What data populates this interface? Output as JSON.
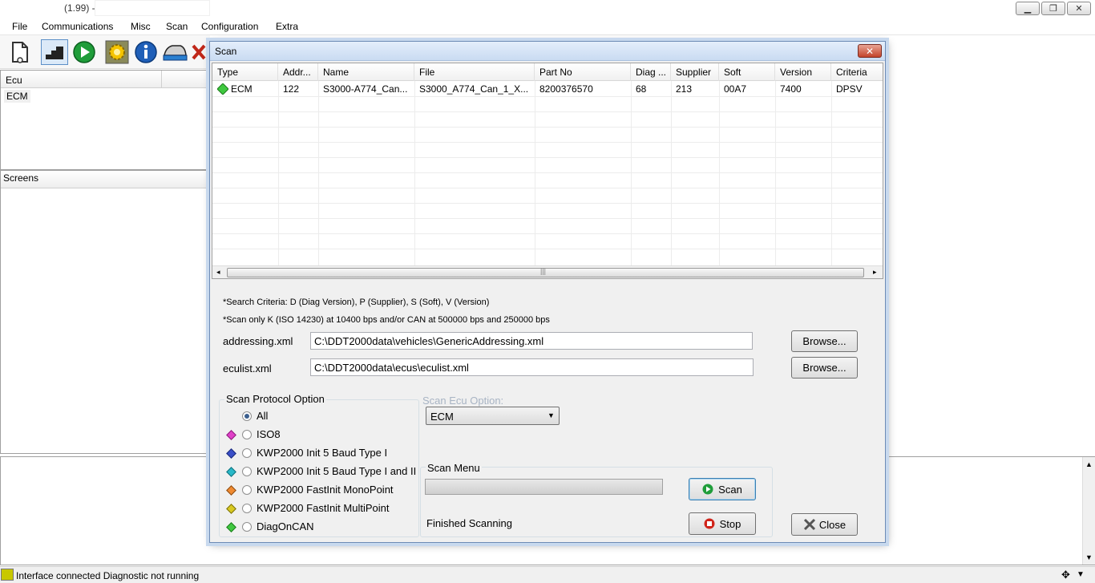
{
  "window": {
    "title_suffix": "(1.99) -"
  },
  "menubar": {
    "items": [
      "File",
      "Communications",
      "Misc",
      "Scan",
      "Configuration",
      "Extra"
    ]
  },
  "panels": {
    "ecu_header": "Ecu",
    "ecu_item": "ECM",
    "screens_header": "Screens"
  },
  "dialog": {
    "title": "Scan",
    "grid": {
      "columns": [
        "Type",
        "Addr...",
        "Name",
        "File",
        "Part No",
        "Diag ...",
        "Supplier",
        "Soft",
        "Version",
        "Criteria"
      ],
      "rows": [
        [
          "ECM",
          "122",
          "S3000-A774_Can...",
          "S3000_A774_Can_1_X...",
          "8200376570",
          "68",
          "213",
          "00A7",
          "7400",
          "DPSV"
        ]
      ]
    },
    "notes": {
      "criteria": "*Search Criteria: D (Diag Version), P (Supplier), S (Soft), V (Version)",
      "scan_only": "*Scan only K (ISO 14230) at 10400 bps and/or CAN at 500000 bps and 250000 bps"
    },
    "addressing": {
      "label": "addressing.xml",
      "value": "C:\\DDT2000data\\vehicles\\GenericAddressing.xml",
      "browse": "Browse..."
    },
    "eculist": {
      "label": "eculist.xml",
      "value": "C:\\DDT2000data\\ecus\\eculist.xml",
      "browse": "Browse..."
    },
    "protocol": {
      "title": "Scan Protocol Option",
      "options": [
        {
          "label": "All",
          "selected": true,
          "color": ""
        },
        {
          "label": "ISO8",
          "selected": false,
          "color": "#e040c8"
        },
        {
          "label": "KWP2000 Init 5 Baud Type I",
          "selected": false,
          "color": "#3a4fc8"
        },
        {
          "label": "KWP2000 Init 5 Baud Type I and II",
          "selected": false,
          "color": "#28b8c8"
        },
        {
          "label": "KWP2000 FastInit MonoPoint",
          "selected": false,
          "color": "#f08a30"
        },
        {
          "label": "KWP2000 FastInit MultiPoint",
          "selected": false,
          "color": "#d8c820"
        },
        {
          "label": "DiagOnCAN",
          "selected": false,
          "color": "#40c840"
        }
      ]
    },
    "ecu_option": {
      "label": "Scan Ecu Option:",
      "selected": "ECM"
    },
    "scan_menu": {
      "title": "Scan Menu",
      "status": "Finished Scanning",
      "scan_button": "Scan",
      "stop_button": "Stop"
    },
    "close_button": "Close"
  },
  "statusbar": {
    "text": "Interface connected Diagnostic not running"
  }
}
